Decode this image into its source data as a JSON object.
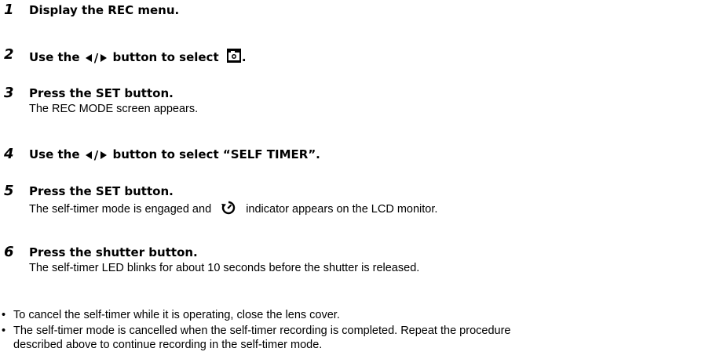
{
  "steps": [
    {
      "number": "1",
      "title": "Display the REC menu.",
      "description": ""
    },
    {
      "number": "2",
      "title_prefix": "Use the",
      "title_slash": "/",
      "title_mid": "button to select",
      "title_suffix": ".",
      "icon": "camera-mode-icon"
    },
    {
      "number": "3",
      "title": "Press the SET button.",
      "description": "The REC MODE screen appears."
    },
    {
      "number": "4",
      "title_prefix": "Use the",
      "title_slash": "/",
      "title_suffix": "button to select “SELF TIMER”."
    },
    {
      "number": "5",
      "title": "Press the SET button.",
      "description_prefix": "The self-timer mode is engaged and",
      "description_suffix": "indicator appears on the LCD monitor.",
      "icon": "self-timer-icon"
    },
    {
      "number": "6",
      "title": "Press the shutter button.",
      "description": "The self-timer LED blinks for about 10 seconds before the shutter is released."
    }
  ],
  "notes": [
    {
      "bullet": "•",
      "text": "To cancel the self-timer while it is operating, close the lens cover."
    },
    {
      "bullet": "•",
      "line1": "The self-timer mode is cancelled when the self-timer recording is completed. Repeat the procedure",
      "line2": "described above to continue recording in the self-timer mode."
    }
  ]
}
